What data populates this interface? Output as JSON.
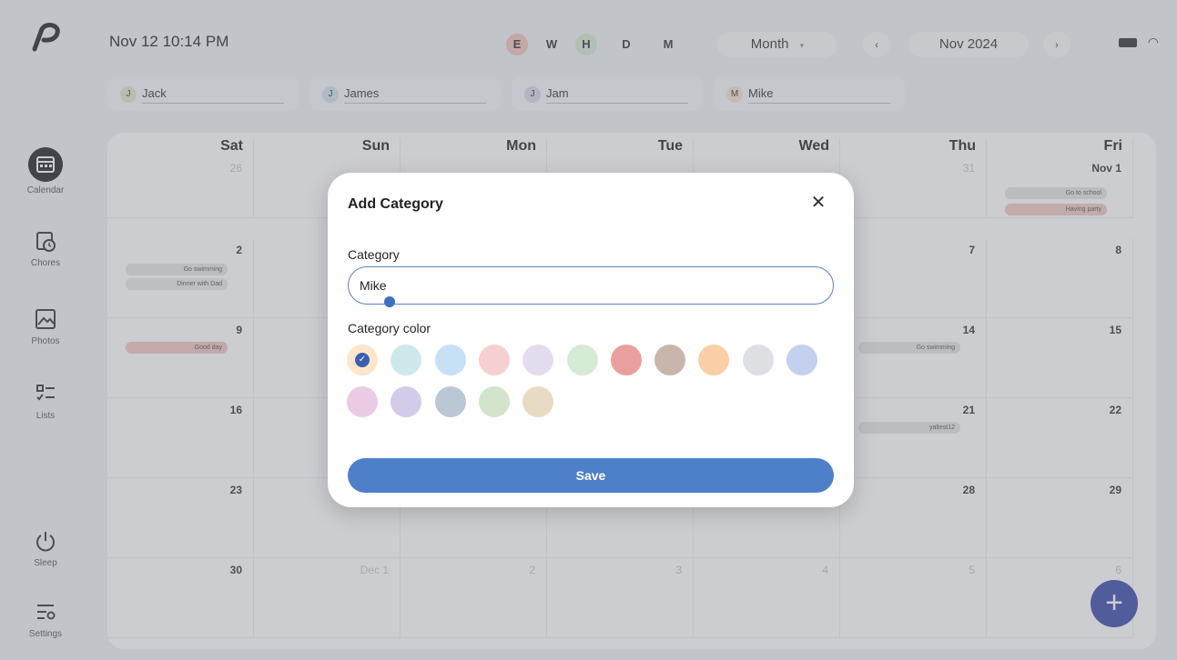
{
  "header": {
    "datetime": "Nov 12 10:14 PM",
    "view_buttons": [
      {
        "label": "E",
        "color": "#f2c2bd"
      },
      {
        "label": "W",
        "color": ""
      },
      {
        "label": "H",
        "color": "#d5e9d3"
      },
      {
        "label": "D",
        "color": ""
      },
      {
        "label": "M",
        "color": ""
      }
    ],
    "view_select": "Month",
    "prev_icon": "chevron-left-icon",
    "current_period": "Nov 2024",
    "next_icon": "chevron-right-icon",
    "status_icons": [
      "battery-icon",
      "wifi-icon"
    ]
  },
  "sidebar": {
    "items": [
      {
        "label": "Calendar",
        "icon": "calendar-icon",
        "active": true
      },
      {
        "label": "Chores",
        "icon": "chores-icon",
        "active": false
      },
      {
        "label": "Photos",
        "icon": "photos-icon",
        "active": false
      },
      {
        "label": "Lists",
        "icon": "lists-icon",
        "active": false
      },
      {
        "label": "Sleep",
        "icon": "power-icon",
        "active": false
      },
      {
        "label": "Settings",
        "icon": "settings-icon",
        "active": false
      }
    ]
  },
  "users": [
    {
      "initial": "J",
      "name": "Jack"
    },
    {
      "initial": "J",
      "name": "James"
    },
    {
      "initial": "J",
      "name": "Jam"
    },
    {
      "initial": "M",
      "name": "Mike"
    }
  ],
  "calendar": {
    "days": [
      "Sat",
      "Sun",
      "Mon",
      "Tue",
      "Wed",
      "Thu",
      "Fri"
    ],
    "weeks": [
      [
        "26",
        "",
        "",
        "",
        "",
        "31",
        "Nov 1"
      ],
      [
        "2",
        "",
        "",
        "",
        "",
        "7",
        "8"
      ],
      [
        "9",
        "",
        "",
        "",
        "",
        "14",
        "15"
      ],
      [
        "16",
        "",
        "",
        "",
        "",
        "21",
        "22"
      ],
      [
        "23",
        "",
        "",
        "",
        "",
        "28",
        "29"
      ],
      [
        "30",
        "Dec 1",
        "2",
        "3",
        "4",
        "5",
        "6"
      ]
    ],
    "events": [
      {
        "text": "Go to school",
        "color": "#e4e4e4"
      },
      {
        "text": "Having party",
        "color": "#f1c9c4"
      },
      {
        "text": "Go swimming",
        "color": "#e6e6e6"
      },
      {
        "text": "Dinner with Dad",
        "color": "#e8e8e8"
      },
      {
        "text": "Good day",
        "color": "#f0c6c2"
      },
      {
        "text": "Go swimming",
        "color": "#e6e6e6"
      },
      {
        "text": "yaltest12",
        "color": "#e6e6e6"
      }
    ]
  },
  "dialog": {
    "title": "Add Category",
    "close_icon": "close-icon",
    "category_label": "Category",
    "category_value": "Mike",
    "color_label": "Category color",
    "colors": [
      "#fce6cc",
      "#cfe8ec",
      "#c6e0f6",
      "#f6d0d0",
      "#e2dcee",
      "#d5ebd3",
      "#e99f9b",
      "#c8b5ab",
      "#fbcfa6",
      "#dedfe3",
      "#c3d0ee",
      "#eacbe4",
      "#d3cbe8",
      "#b9c8d4",
      "#d3e4cc",
      "#e7dcc3"
    ],
    "selected_color_index": 0,
    "save_label": "Save"
  }
}
